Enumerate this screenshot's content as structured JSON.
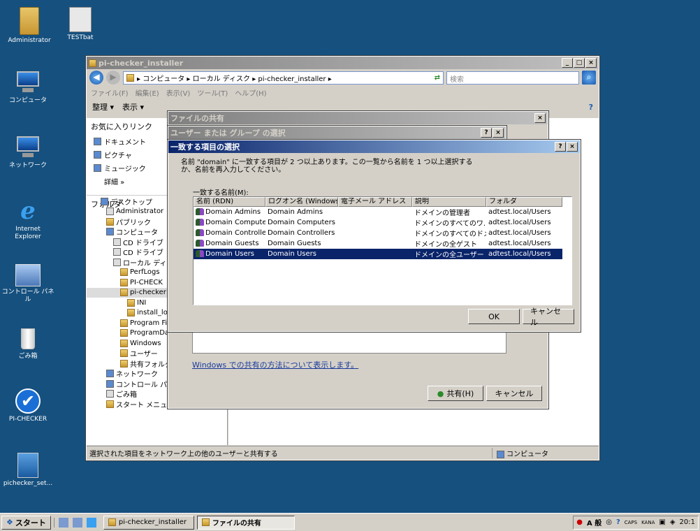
{
  "desktop": {
    "icons": [
      {
        "label": "Administrator",
        "icon": "folder-icon"
      },
      {
        "label": "TESTbat",
        "icon": "batch-file-icon"
      },
      {
        "label": "コンピュータ",
        "icon": "computer-icon"
      },
      {
        "label": "ネットワーク",
        "icon": "network-icon"
      },
      {
        "label": "Internet Explorer",
        "icon": "internet-explorer-icon"
      },
      {
        "label": "コントロール パネル",
        "icon": "control-panel-icon"
      },
      {
        "label": "ごみ箱",
        "icon": "recycle-bin-icon"
      },
      {
        "label": "PI-CHECKER",
        "icon": "pi-checker-icon"
      },
      {
        "label": "pichecker_set...",
        "icon": "installer-icon"
      }
    ]
  },
  "explorer": {
    "title": "pi-checker_installer",
    "address": "▸ コンピュータ ▸ ローカル ディスク ▸ pi-checker_installer ▸",
    "search_placeholder": "検索",
    "menu": [
      "ファイル(F)",
      "編集(E)",
      "表示(V)",
      "ツール(T)",
      "ヘルプ(H)"
    ],
    "toolbar": {
      "organize": "整理 ▾",
      "view": "表示 ▾"
    },
    "favorites_header": "お気に入りリンク",
    "favorites": [
      "ドキュメント",
      "ピクチャ",
      "ミュージック",
      "詳細 »"
    ],
    "folders_header": "フォルダ",
    "tree": [
      "デスクトップ",
      "Administrator",
      "パブリック",
      "コンピュータ",
      "CD ドライブ",
      "CD ドライブ",
      "ローカル ディスク",
      "PerfLogs",
      "PI-CHECK",
      "pi-checker",
      "INI",
      "install_lo",
      "Program Fi",
      "ProgramDa",
      "Windows",
      "ユーザー",
      "共有フォルダ",
      "ネットワーク",
      "コントロール パネル",
      "ごみ箱",
      "スタート メニュー"
    ],
    "status_text": "選択された項目をネットワーク上の他のユーザーと共有する",
    "status_location": "コンピュータ"
  },
  "share_dialog": {
    "title": "ファイルの共有",
    "help_link": "Windows での共有の方法について表示します。",
    "share_button": "共有(H)",
    "cancel_button": "キャンセル"
  },
  "select_users_dialog": {
    "title": "ユーザー または グループ の選択"
  },
  "multiple_names_dialog": {
    "title": "一致する項目の選択",
    "message": "名前 \"domain\" に一致する項目が 2 つ以上あります。この一覧から名前を 1 つ以上選択するか、名前を再入力してください。",
    "list_label": "一致する名前(M):",
    "columns": [
      "名前 (RDN)",
      "ログオン名 (Windows...",
      "電子メール アドレス",
      "説明",
      "フォルダ"
    ],
    "rows": [
      [
        "Domain Admins",
        "Domain Admins",
        "",
        "ドメインの管理者",
        "adtest.local/Users"
      ],
      [
        "Domain Compute...",
        "Domain Computers",
        "",
        "ドメインのすべてのワ...",
        "adtest.local/Users"
      ],
      [
        "Domain Controlle...",
        "Domain Controllers",
        "",
        "ドメインのすべてのドメ...",
        "adtest.local/Users"
      ],
      [
        "Domain Guests",
        "Domain Guests",
        "",
        "ドメインの全ゲスト",
        "adtest.local/Users"
      ],
      [
        "Domain Users",
        "Domain Users",
        "",
        "ドメインの全ユーザー",
        "adtest.local/Users"
      ]
    ],
    "selected_row": 4,
    "ok_button": "OK",
    "cancel_button": "キャンセル"
  },
  "taskbar": {
    "start_label": "スタート",
    "tasks": [
      "pi-checker_installer",
      "ファイルの共有"
    ],
    "tray": {
      "ime": "A 般",
      "caps": "CAPS",
      "kana": "KANA",
      "clock": "20:1"
    }
  }
}
